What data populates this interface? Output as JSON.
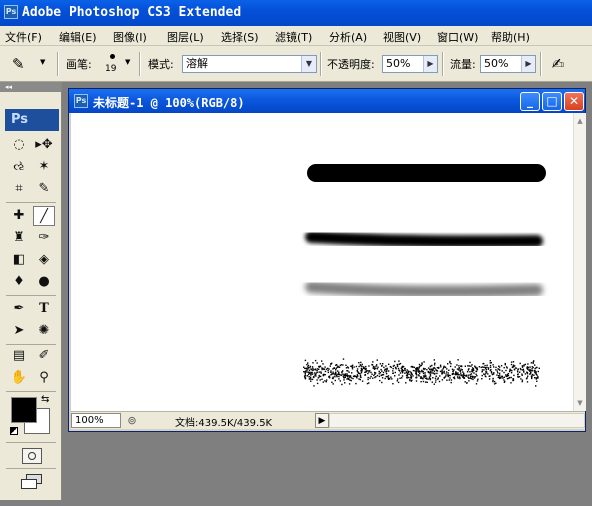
{
  "app": {
    "title": "Adobe Photoshop CS3 Extended",
    "logo": "Ps"
  },
  "menu": [
    {
      "label": "文件(F)"
    },
    {
      "label": "编辑(E)"
    },
    {
      "label": "图像(I)"
    },
    {
      "label": "图层(L)"
    },
    {
      "label": "选择(S)"
    },
    {
      "label": "滤镜(T)"
    },
    {
      "label": "分析(A)"
    },
    {
      "label": "视图(V)"
    },
    {
      "label": "窗口(W)"
    },
    {
      "label": "帮助(H)"
    }
  ],
  "options": {
    "brush_label": "画笔:",
    "brush_size": "19",
    "mode_label": "模式:",
    "mode_value": "溶解",
    "opacity_label": "不透明度:",
    "opacity_value": "50%",
    "flow_label": "流量:",
    "flow_value": "50%"
  },
  "toolbox": {
    "badge": "Ps",
    "header_arrows": "◂◂",
    "tools": [
      {
        "name": "marquee-tool",
        "glyph": "◌"
      },
      {
        "name": "move-tool",
        "glyph": "▸✥"
      },
      {
        "name": "lasso-tool",
        "glyph": "ઌ"
      },
      {
        "name": "magic-wand-tool",
        "glyph": "✶"
      },
      {
        "name": "crop-tool",
        "glyph": "⌗"
      },
      {
        "name": "slice-tool",
        "glyph": "✎"
      },
      {
        "name": "healing-brush-tool",
        "glyph": "✚"
      },
      {
        "name": "brush-tool",
        "glyph": "╱"
      },
      {
        "name": "clone-stamp-tool",
        "glyph": "♜"
      },
      {
        "name": "history-brush-tool",
        "glyph": "✑"
      },
      {
        "name": "eraser-tool",
        "glyph": "◧"
      },
      {
        "name": "paint-bucket-tool",
        "glyph": "◈"
      },
      {
        "name": "blur-tool",
        "glyph": "♦"
      },
      {
        "name": "dodge-tool",
        "glyph": "●"
      },
      {
        "name": "pen-tool",
        "glyph": "✒"
      },
      {
        "name": "type-tool",
        "glyph": "T"
      },
      {
        "name": "path-selection-tool",
        "glyph": "➤"
      },
      {
        "name": "custom-shape-tool",
        "glyph": "✺"
      },
      {
        "name": "notes-tool",
        "glyph": "▤"
      },
      {
        "name": "eyedropper-tool",
        "glyph": "✐"
      },
      {
        "name": "hand-tool",
        "glyph": "✋"
      },
      {
        "name": "zoom-tool",
        "glyph": "⚲"
      }
    ]
  },
  "document": {
    "title": "未标题-1 @ 100%(RGB/8)",
    "logo": "Ps",
    "zoom": "100%",
    "doc_info": "文档:439.5K/439.5K"
  },
  "colors": {
    "title_bar": "#0550d8",
    "menu_bg": "#ece9d8",
    "close_button": "#d8401f"
  }
}
